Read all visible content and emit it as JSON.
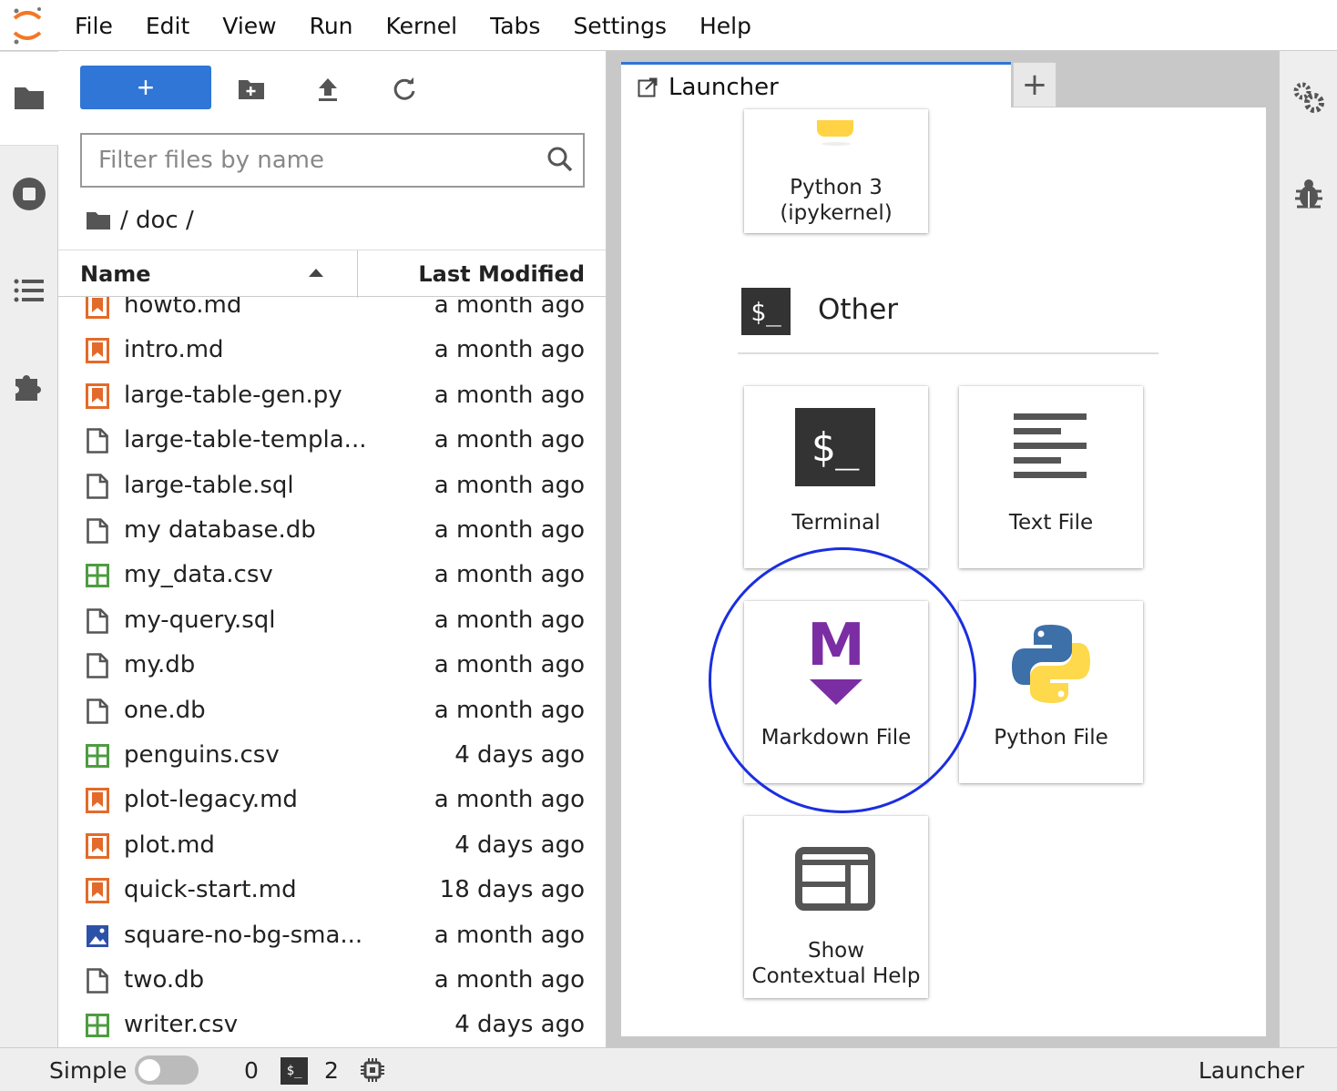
{
  "menubar": {
    "items": [
      "File",
      "Edit",
      "View",
      "Run",
      "Kernel",
      "Tabs",
      "Settings",
      "Help"
    ]
  },
  "filebrowser": {
    "new_label": "+",
    "filter_placeholder": "Filter files by name",
    "breadcrumb": "/ doc /",
    "col_name": "Name",
    "col_modified": "Last Modified",
    "files": [
      {
        "name": "howto.md",
        "modified": "a month ago",
        "type": "markdown"
      },
      {
        "name": "intro.md",
        "modified": "a month ago",
        "type": "markdown"
      },
      {
        "name": "large-table-gen.py",
        "modified": "a month ago",
        "type": "markdown"
      },
      {
        "name": "large-table-templa...",
        "modified": "a month ago",
        "type": "file"
      },
      {
        "name": "large-table.sql",
        "modified": "a month ago",
        "type": "file"
      },
      {
        "name": "my database.db",
        "modified": "a month ago",
        "type": "file"
      },
      {
        "name": "my_data.csv",
        "modified": "a month ago",
        "type": "csv"
      },
      {
        "name": "my-query.sql",
        "modified": "a month ago",
        "type": "file"
      },
      {
        "name": "my.db",
        "modified": "a month ago",
        "type": "file"
      },
      {
        "name": "one.db",
        "modified": "a month ago",
        "type": "file"
      },
      {
        "name": "penguins.csv",
        "modified": "4 days ago",
        "type": "csv"
      },
      {
        "name": "plot-legacy.md",
        "modified": "a month ago",
        "type": "markdown"
      },
      {
        "name": "plot.md",
        "modified": "4 days ago",
        "type": "markdown"
      },
      {
        "name": "quick-start.md",
        "modified": "18 days ago",
        "type": "markdown"
      },
      {
        "name": "square-no-bg-sma...",
        "modified": "a month ago",
        "type": "image"
      },
      {
        "name": "two.db",
        "modified": "a month ago",
        "type": "file"
      },
      {
        "name": "writer.csv",
        "modified": "4 days ago",
        "type": "csv"
      }
    ]
  },
  "tabs": {
    "launcher_label": "Launcher",
    "add_label": "+"
  },
  "launcher": {
    "python_kernel": "Python 3\n(ipykernel)",
    "other_heading": "Other",
    "other_icon_text": "$_",
    "cards": {
      "terminal": "Terminal",
      "text_file": "Text File",
      "markdown_file": "Markdown File",
      "python_file": "Python File",
      "contextual_help": "Show\nContextual Help"
    },
    "terminal_icon_text": "$_",
    "markdown_icon_letter": "M"
  },
  "statusbar": {
    "simple_label": "Simple",
    "kernel_count": "0",
    "terminal_icon_text": "$_",
    "terminal_count": "2",
    "right_label": "Launcher"
  },
  "colors": {
    "accent": "#2f76d6",
    "markdown_icon": "#e36a2a",
    "csv_icon": "#4e9c41",
    "image_icon": "#2c51a8",
    "markdown_purple": "#7b2ea3",
    "highlight_circle": "#1a2ee0"
  }
}
